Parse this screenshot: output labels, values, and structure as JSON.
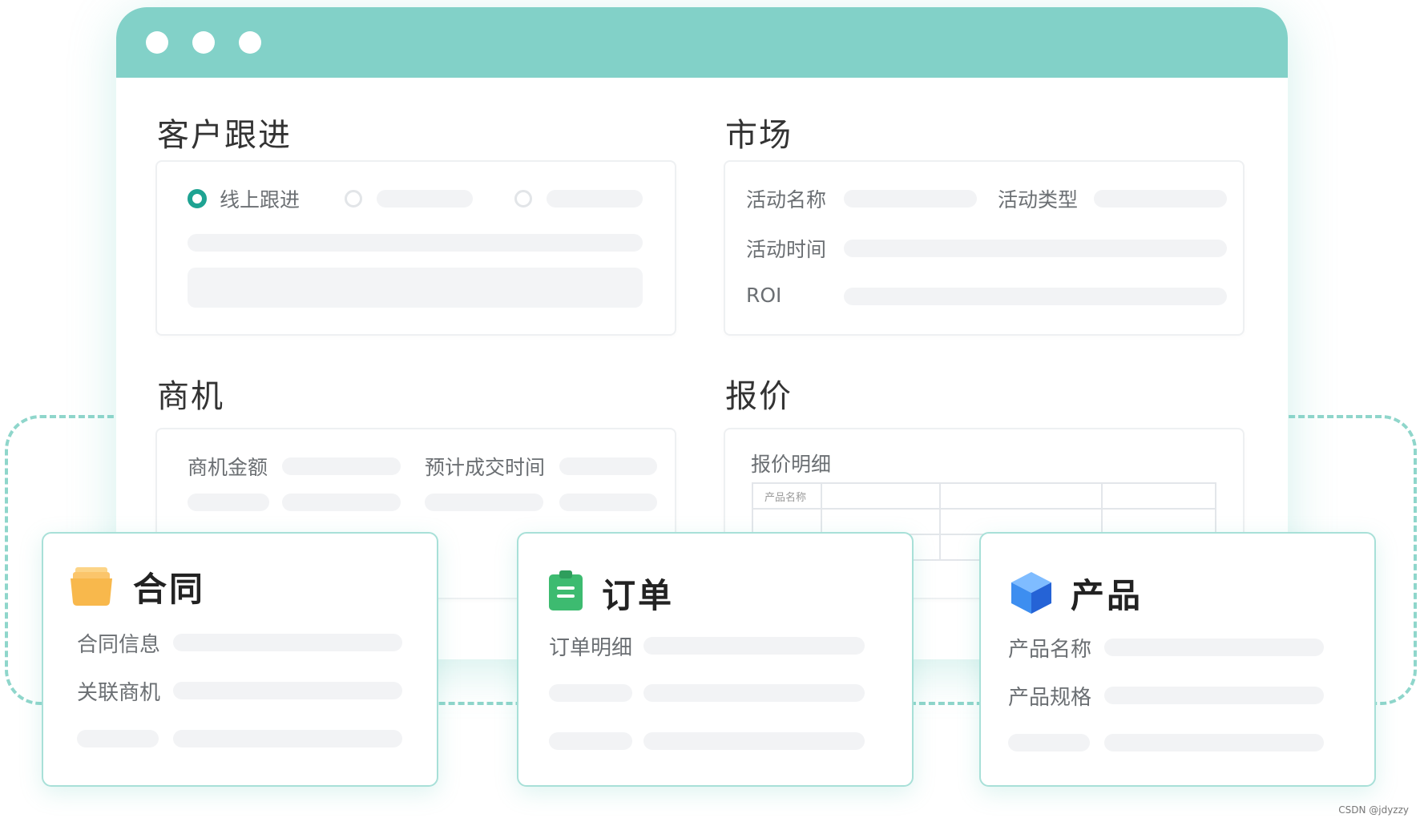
{
  "sections": {
    "customer_followup": {
      "title": "客户跟进",
      "selected_option": "线上跟进"
    },
    "market": {
      "title": "市场",
      "fields": [
        "活动名称",
        "活动类型",
        "活动时间",
        "ROI"
      ]
    },
    "opportunity": {
      "title": "商机",
      "fields": [
        "商机金额",
        "预计成交时间"
      ]
    },
    "quote": {
      "title": "报价",
      "detail_label": "报价明细",
      "table_header": "产品名称"
    }
  },
  "cards": {
    "contract": {
      "title": "合同",
      "icon": "folder-icon",
      "icon_color": "#f8b84c",
      "fields": [
        "合同信息",
        "关联商机"
      ]
    },
    "order": {
      "title": "订单",
      "icon": "clipboard-icon",
      "icon_color": "#3dbb70",
      "fields": [
        "订单明细"
      ]
    },
    "product": {
      "title": "产品",
      "icon": "cube-icon",
      "icon_color": "#3d8ef0",
      "fields": [
        "产品名称",
        "产品规格"
      ]
    }
  },
  "colors": {
    "titlebar": "#82d1c8",
    "accent": "#1ea392",
    "dashed_border": "#8fd6cb"
  },
  "watermark": "CSDN @jdyzzy"
}
